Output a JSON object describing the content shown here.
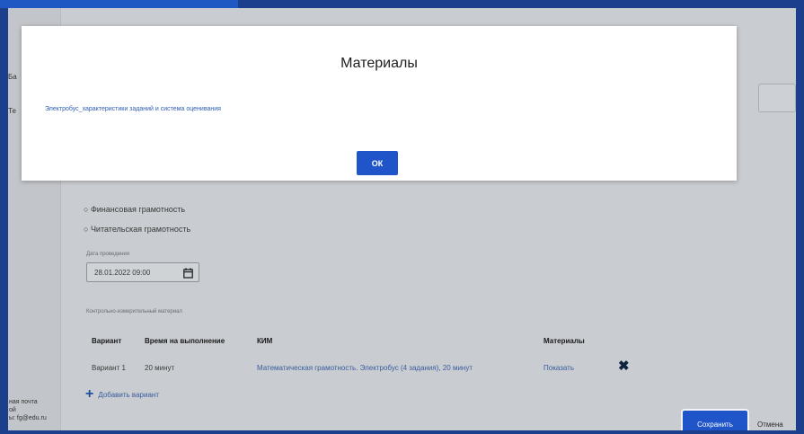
{
  "colors": {
    "accent": "#1f55c8",
    "frame": "#1b3f8c",
    "link": "#3a5d9e"
  },
  "left_panel": {
    "fragments": [
      "Ба",
      "Те"
    ],
    "footer_lines": [
      "ная почта",
      "ой",
      "ы: fg@edu.ru"
    ]
  },
  "form": {
    "radio_options": [
      "Финансовая грамотность",
      "Читательская грамотность"
    ],
    "date": {
      "label": "Дата проведения",
      "value": "28.01.2022 09:00",
      "icon": "calendar-icon"
    },
    "kim_caption": "Контрольно-измерительный материал",
    "table": {
      "headers": [
        "Вариант",
        "Время на выполнение",
        "КИМ",
        "Материалы"
      ],
      "rows": [
        {
          "variant": "Вариант 1",
          "time": "20 минут",
          "kim": "Математическая грамотность. Электробус (4 задания), 20 минут",
          "materials": "Показать",
          "remove_icon": "close-icon"
        }
      ]
    },
    "add_variant_label": "Добавить вариант"
  },
  "footer": {
    "save_label": "Сохранить",
    "cancel_label": "Отмена"
  },
  "modal": {
    "title": "Материалы",
    "link_text": "Электробус_характеристики заданий и система оценивания",
    "ok_label": "ОК"
  }
}
